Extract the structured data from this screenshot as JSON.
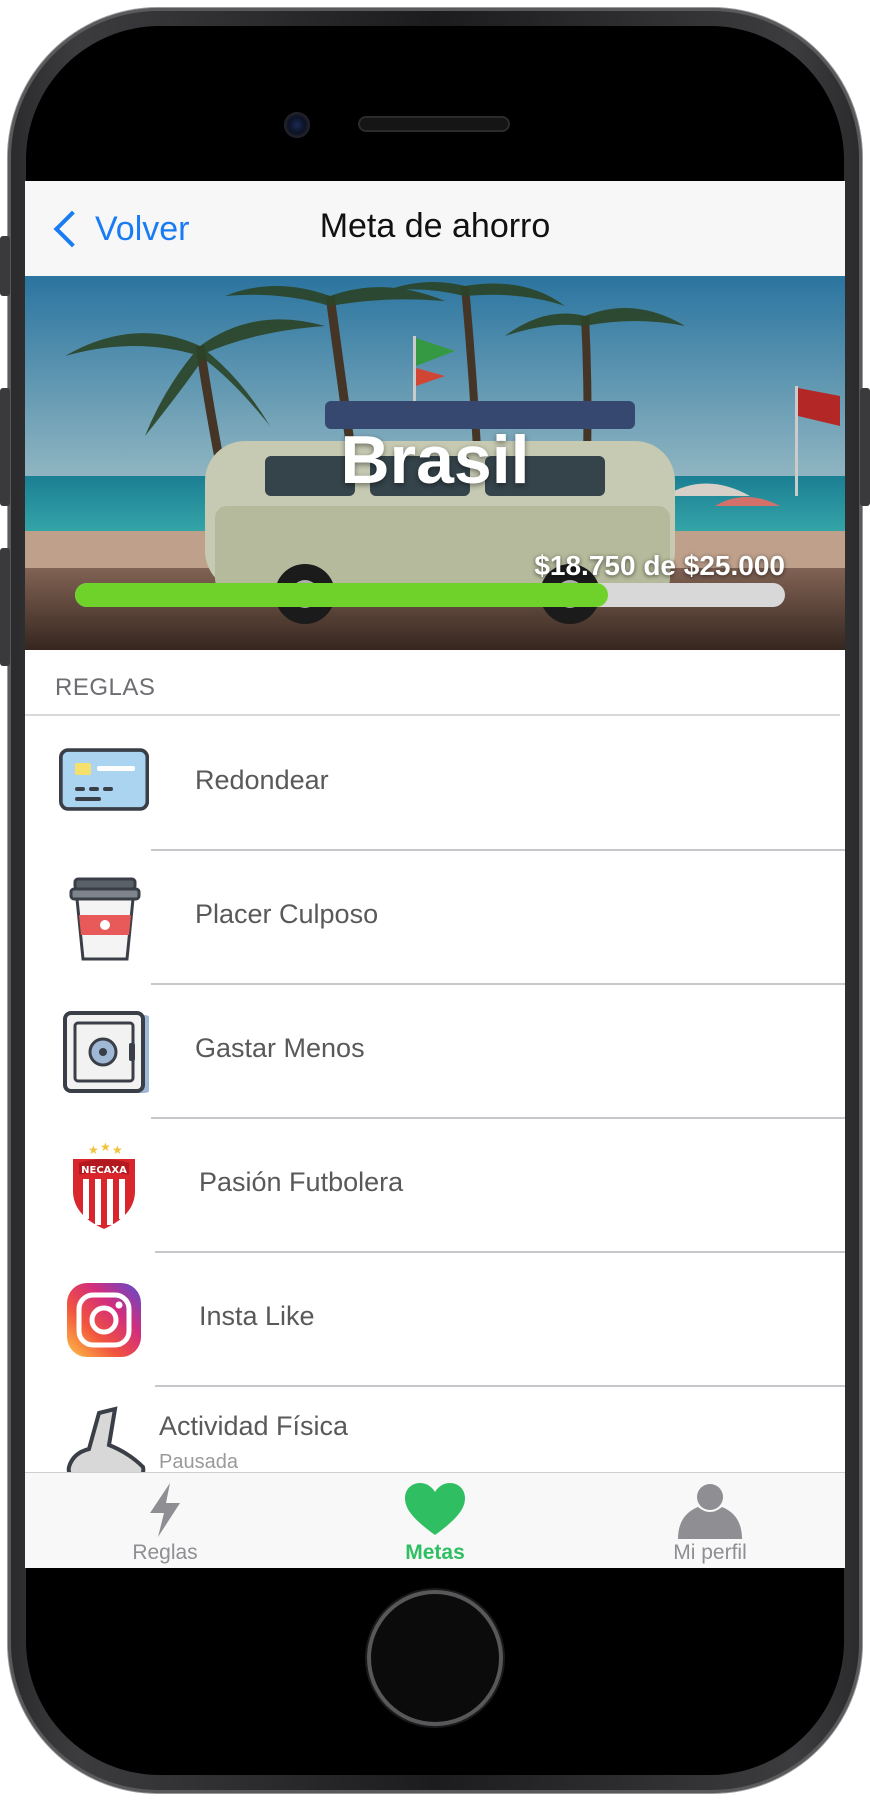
{
  "navbar": {
    "back_label": "Volver",
    "title": "Meta de ahorro"
  },
  "goal": {
    "name": "Brasil",
    "amount_text": "$18.750 de $25.000",
    "saved": 18750,
    "target": 25000,
    "progress_fraction": 0.75,
    "progress_color": "#6ed22a"
  },
  "rules_section": {
    "header": "REGLAS",
    "items": [
      {
        "label": "Redondear",
        "icon": "credit-card-icon"
      },
      {
        "label": "Placer Culposo",
        "icon": "coffee-cup-icon"
      },
      {
        "label": "Gastar Menos",
        "icon": "safe-icon"
      },
      {
        "label": "Pasión Futbolera",
        "icon": "necaxa-crest-icon",
        "crest_text": "NECAXA"
      },
      {
        "label": "Insta Like",
        "icon": "instagram-icon"
      },
      {
        "label": "Actividad Física",
        "sublabel": "Pausada",
        "icon": "running-shoe-icon"
      }
    ]
  },
  "tabbar": {
    "tabs": [
      {
        "label": "Reglas",
        "icon": "lightning-icon",
        "active": false
      },
      {
        "label": "Metas",
        "icon": "heart-icon",
        "active": true
      },
      {
        "label": "Mi perfil",
        "icon": "person-icon",
        "active": false
      }
    ],
    "active_color": "#2fbf62",
    "inactive_color": "#8e8e93"
  },
  "colors": {
    "accent": "#1a7cf4"
  }
}
